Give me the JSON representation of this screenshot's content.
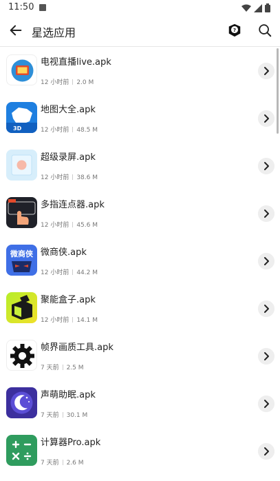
{
  "status": {
    "time": "11:50"
  },
  "header": {
    "title": "星选应用"
  },
  "apps": [
    {
      "name": "电视直播live.apk",
      "time": "12 小时前",
      "size": "2.0 M",
      "icon": "tv-live-icon"
    },
    {
      "name": "地图大全.apk",
      "time": "12 小时前",
      "size": "48.5 M",
      "icon": "map-icon"
    },
    {
      "name": "超级录屏.apk",
      "time": "12 小时前",
      "size": "38.6 M",
      "icon": "screen-record-icon"
    },
    {
      "name": "多指连点器.apk",
      "time": "12 小时前",
      "size": "45.6 M",
      "icon": "auto-clicker-icon"
    },
    {
      "name": "微商侠.apk",
      "time": "12 小时前",
      "size": "44.2 M",
      "icon": "weishangxia-icon",
      "icon_text": "微商侠"
    },
    {
      "name": "聚能盒子.apk",
      "time": "12 小时前",
      "size": "14.1 M",
      "icon": "box-icon"
    },
    {
      "name": "帧界画质工具.apk",
      "time": "7 天前",
      "size": "2.5 M",
      "icon": "gear-settings-icon"
    },
    {
      "name": "声萌助眠.apk",
      "time": "7 天前",
      "size": "30.1 M",
      "icon": "moon-sleep-icon"
    },
    {
      "name": "计算器Pro.apk",
      "time": "7 天前",
      "size": "2.6 M",
      "icon": "calculator-icon"
    }
  ]
}
